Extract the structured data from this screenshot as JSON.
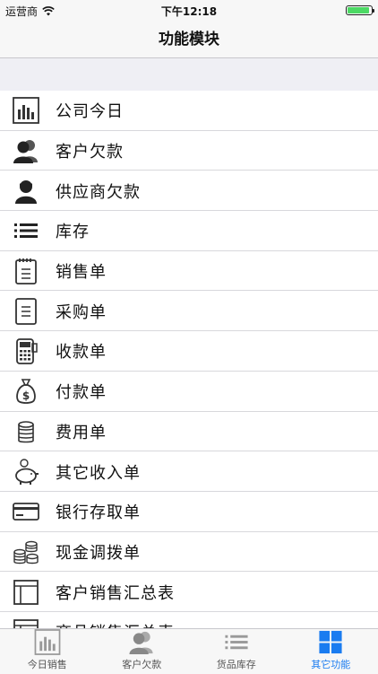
{
  "status": {
    "carrier": "运营商",
    "time": "下午12:18"
  },
  "nav": {
    "title": "功能模块"
  },
  "menu": [
    {
      "label": "公司今日",
      "icon": "bar-chart-icon"
    },
    {
      "label": "客户欠款",
      "icon": "customers-icon"
    },
    {
      "label": "供应商欠款",
      "icon": "supplier-icon"
    },
    {
      "label": "库存",
      "icon": "list-icon"
    },
    {
      "label": "销售单",
      "icon": "notepad-icon"
    },
    {
      "label": "采购单",
      "icon": "document-icon"
    },
    {
      "label": "收款单",
      "icon": "pos-terminal-icon"
    },
    {
      "label": "付款单",
      "icon": "money-bag-icon"
    },
    {
      "label": "费用单",
      "icon": "coins-stack-icon"
    },
    {
      "label": "其它收入单",
      "icon": "piggy-bank-icon"
    },
    {
      "label": "银行存取单",
      "icon": "credit-card-icon"
    },
    {
      "label": "现金调拨单",
      "icon": "coin-piles-icon"
    },
    {
      "label": "客户销售汇总表",
      "icon": "report-icon"
    },
    {
      "label": "商品销售汇总表",
      "icon": "report-icon"
    }
  ],
  "tabs": [
    {
      "label": "今日销售",
      "icon": "bar-chart-icon",
      "active": false
    },
    {
      "label": "客户欠款",
      "icon": "customers-icon",
      "active": false
    },
    {
      "label": "货品库存",
      "icon": "list-icon",
      "active": false
    },
    {
      "label": "其它功能",
      "icon": "grid-icon",
      "active": true
    }
  ],
  "colors": {
    "accent": "#1a7cf0",
    "battery": "#4cd964"
  }
}
